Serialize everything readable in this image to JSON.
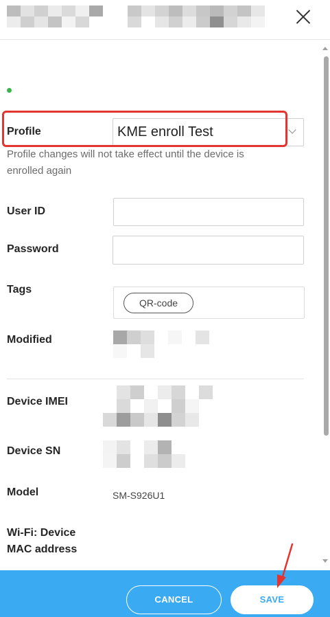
{
  "form": {
    "profile_label": "Profile",
    "profile_value": "KME enroll Test",
    "profile_hint": "Profile changes will not take effect until the device is enrolled again",
    "user_id_label": "User ID",
    "user_id_value": "",
    "password_label": "Password",
    "password_value": "",
    "tags_label": "Tags",
    "tags": [
      "QR-code"
    ],
    "modified_label": "Modified",
    "device_imei_label": "Device IMEI",
    "device_sn_label": "Device SN",
    "model_label": "Model",
    "model_value": "SM-S926U1",
    "wifi_mac_label_line1": "Wi-Fi: Device",
    "wifi_mac_label_line2": "MAC address"
  },
  "footer": {
    "cancel_label": "CANCEL",
    "save_label": "SAVE"
  },
  "icons": {
    "close": "close-icon",
    "dropdown": "chevron-down-icon"
  },
  "colors": {
    "accent": "#3aabf2",
    "highlight": "#e3342f",
    "status_dot": "#3bb54a"
  }
}
